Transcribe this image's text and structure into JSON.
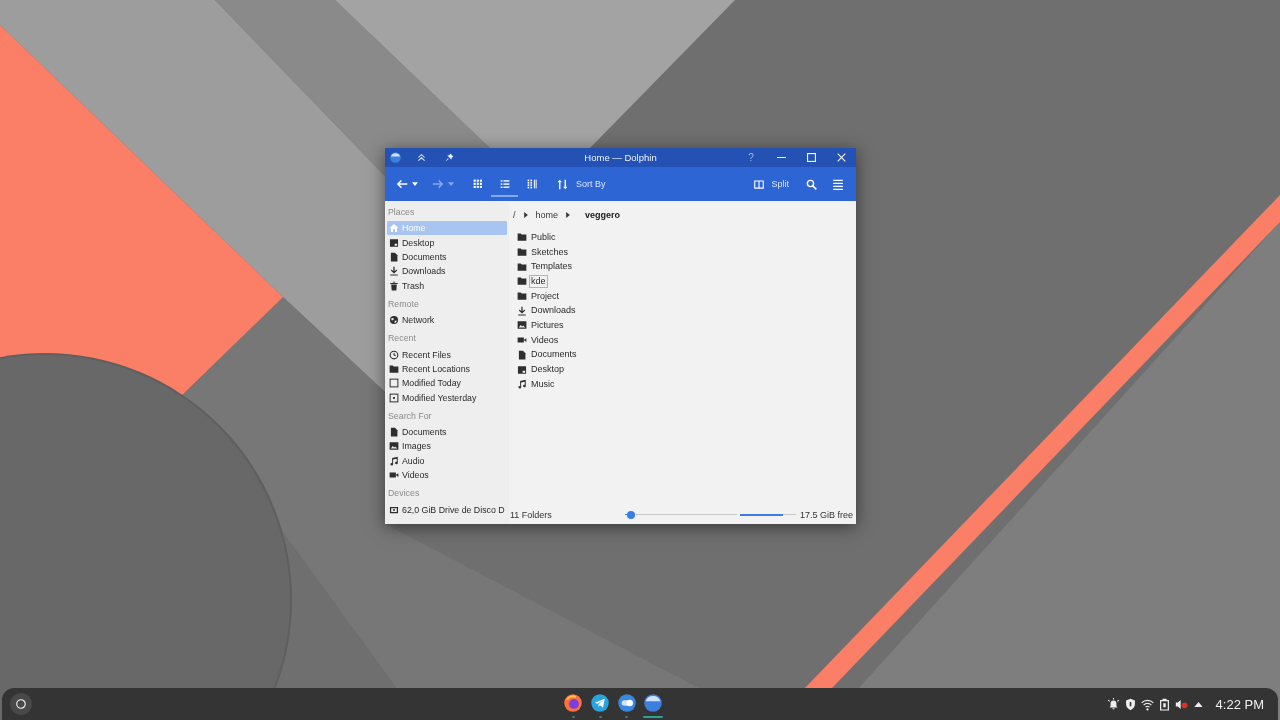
{
  "window": {
    "title": "Home — Dolphin",
    "help": "?"
  },
  "toolbar": {
    "navigation": [
      {
        "kind": "back",
        "disabled": false
      },
      {
        "kind": "forward",
        "disabled": true
      }
    ],
    "view_modes": [
      {
        "kind": "icons",
        "selected": false
      },
      {
        "kind": "details",
        "selected": true
      },
      {
        "kind": "compact",
        "selected": false
      }
    ],
    "sort": {
      "label": "Sort By"
    },
    "split": {
      "label": "Split"
    }
  },
  "places": {
    "sections": [
      {
        "heading": "Places",
        "items": [
          {
            "label": "Home",
            "kind": "home",
            "selected": true
          },
          {
            "label": "Desktop",
            "kind": "desktop",
            "selected": false
          },
          {
            "label": "Documents",
            "kind": "document",
            "selected": false
          },
          {
            "label": "Downloads",
            "kind": "download",
            "selected": false
          },
          {
            "label": "Trash",
            "kind": "trash",
            "selected": false
          }
        ]
      },
      {
        "heading": "Remote",
        "items": [
          {
            "label": "Network",
            "kind": "network",
            "selected": false
          }
        ]
      },
      {
        "heading": "Recent",
        "items": [
          {
            "label": "Recent Files",
            "kind": "clock",
            "selected": false
          },
          {
            "label": "Recent Locations",
            "kind": "folder",
            "selected": false
          },
          {
            "label": "Modified Today",
            "kind": "today",
            "selected": false
          },
          {
            "label": "Modified Yesterday",
            "kind": "yesterday",
            "selected": false
          }
        ]
      },
      {
        "heading": "Search For",
        "items": [
          {
            "label": "Documents",
            "kind": "document",
            "selected": false
          },
          {
            "label": "Images",
            "kind": "image",
            "selected": false
          },
          {
            "label": "Audio",
            "kind": "audio",
            "selected": false
          },
          {
            "label": "Videos",
            "kind": "video",
            "selected": false
          }
        ]
      },
      {
        "heading": "Devices",
        "items": [
          {
            "label": "62,0 GiB Drive de Disco D",
            "kind": "drive",
            "selected": false
          }
        ]
      }
    ]
  },
  "location": {
    "segments": [
      {
        "label": "/",
        "current": false
      },
      {
        "label": "home",
        "current": false
      },
      {
        "label": "veggero",
        "current": true
      }
    ]
  },
  "files": [
    {
      "label": "Public",
      "kind": "folder",
      "focused": false
    },
    {
      "label": "Sketches",
      "kind": "folder",
      "focused": false
    },
    {
      "label": "Templates",
      "kind": "folder",
      "focused": false
    },
    {
      "label": "kde",
      "kind": "folder",
      "focused": true
    },
    {
      "label": "Project",
      "kind": "folder",
      "focused": false
    },
    {
      "label": "Downloads",
      "kind": "download",
      "focused": false
    },
    {
      "label": "Pictures",
      "kind": "image",
      "focused": false
    },
    {
      "label": "Videos",
      "kind": "video",
      "focused": false
    },
    {
      "label": "Documents",
      "kind": "document",
      "focused": false
    },
    {
      "label": "Desktop",
      "kind": "desktop",
      "focused": false
    },
    {
      "label": "Music",
      "kind": "audio",
      "focused": false
    }
  ],
  "status_bar": {
    "summary": "11 Folders",
    "zoom": {
      "level": 0.05
    },
    "free_space": {
      "level": 0.77,
      "reading": "17.5 GiB free"
    }
  },
  "taskbar": {
    "tasks": [
      {
        "kind": "browser",
        "active": false
      },
      {
        "kind": "messenger",
        "active": false
      },
      {
        "kind": "toggle",
        "active": false
      },
      {
        "kind": "files",
        "active": true
      }
    ],
    "tray": [
      {
        "kind": "alert"
      },
      {
        "kind": "shield"
      },
      {
        "kind": "wifi"
      },
      {
        "kind": "battery"
      },
      {
        "kind": "volume-muted"
      },
      {
        "kind": "expand"
      }
    ],
    "clock": "4:22 PM"
  }
}
